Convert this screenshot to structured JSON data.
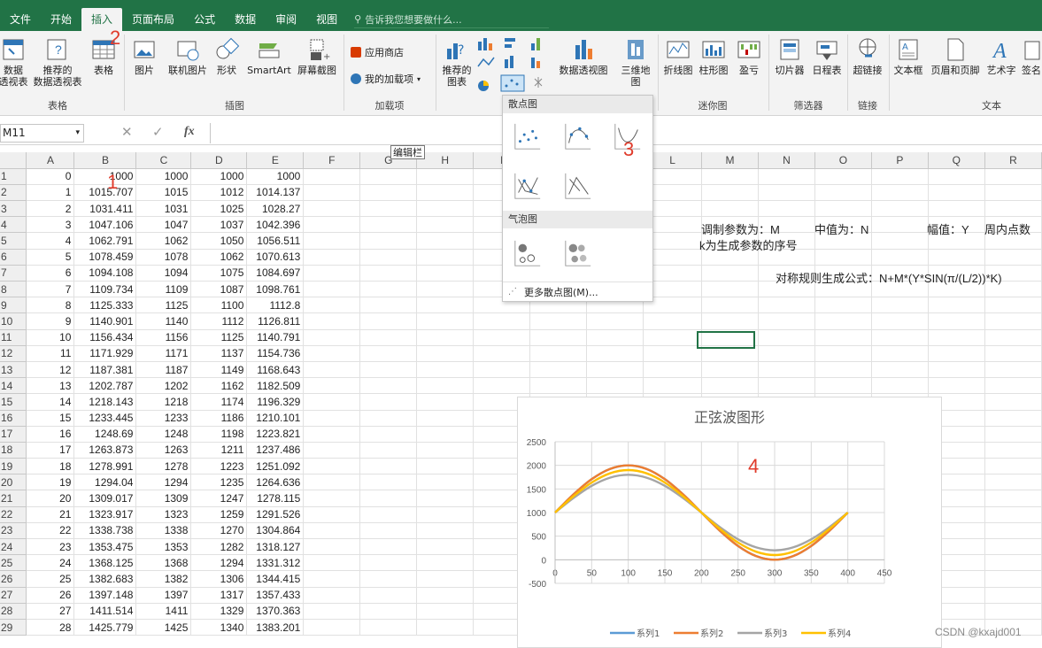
{
  "tabs": [
    "文件",
    "开始",
    "插入",
    "页面布局",
    "公式",
    "数据",
    "审阅",
    "视图"
  ],
  "active_tab": "插入",
  "tell_me": "告诉我您想要做什么...",
  "ribbon": {
    "pivot": "数据\n透视表",
    "rec_pivot": "推荐的\n数据透视表",
    "table": "表格",
    "picture": "图片",
    "online_picture": "联机图片",
    "shapes": "形状",
    "smartart": "SmartArt",
    "screenshot": "屏幕截图",
    "store": "应用商店",
    "my_addins": "我的加载项",
    "rec_charts": "推荐的\n图表",
    "pivot_chart": "数据透视图",
    "map3d": "三维地\n图",
    "line": "折线图",
    "column": "柱形图",
    "winloss": "盈亏",
    "slicer": "切片器",
    "timeline": "日程表",
    "hyperlink": "超链接",
    "textbox": "文本框",
    "header_footer": "页眉和页脚",
    "wordart": "艺术字",
    "signature": "签名",
    "groups": {
      "tables": "表格",
      "illustrations": "插图",
      "addins": "加载项",
      "sparklines": "迷你图",
      "filters": "筛选器",
      "links": "链接",
      "text": "文本"
    }
  },
  "namebox": "M11",
  "fx": "fx",
  "formula_tooltip": "编辑栏",
  "columns": [
    "A",
    "B",
    "C",
    "D",
    "E",
    "F",
    "G",
    "H",
    "I",
    "J",
    "K",
    "L",
    "M",
    "N",
    "O",
    "P",
    "Q",
    "R"
  ],
  "rows": [
    [
      "1",
      "0",
      "1000",
      "1000",
      "1000",
      "1000"
    ],
    [
      "2",
      "1",
      "1015.707",
      "1015",
      "1012",
      "1014.137"
    ],
    [
      "3",
      "2",
      "1031.411",
      "1031",
      "1025",
      "1028.27"
    ],
    [
      "4",
      "3",
      "1047.106",
      "1047",
      "1037",
      "1042.396"
    ],
    [
      "5",
      "4",
      "1062.791",
      "1062",
      "1050",
      "1056.511"
    ],
    [
      "6",
      "5",
      "1078.459",
      "1078",
      "1062",
      "1070.613"
    ],
    [
      "7",
      "6",
      "1094.108",
      "1094",
      "1075",
      "1084.697"
    ],
    [
      "8",
      "7",
      "1109.734",
      "1109",
      "1087",
      "1098.761"
    ],
    [
      "9",
      "8",
      "1125.333",
      "1125",
      "1100",
      "1112.8"
    ],
    [
      "10",
      "9",
      "1140.901",
      "1140",
      "1112",
      "1126.811"
    ],
    [
      "11",
      "10",
      "1156.434",
      "1156",
      "1125",
      "1140.791"
    ],
    [
      "12",
      "11",
      "1171.929",
      "1171",
      "1137",
      "1154.736"
    ],
    [
      "13",
      "12",
      "1187.381",
      "1187",
      "1149",
      "1168.643"
    ],
    [
      "14",
      "13",
      "1202.787",
      "1202",
      "1162",
      "1182.509"
    ],
    [
      "15",
      "14",
      "1218.143",
      "1218",
      "1174",
      "1196.329"
    ],
    [
      "16",
      "15",
      "1233.445",
      "1233",
      "1186",
      "1210.101"
    ],
    [
      "17",
      "16",
      "1248.69",
      "1248",
      "1198",
      "1223.821"
    ],
    [
      "18",
      "17",
      "1263.873",
      "1263",
      "1211",
      "1237.486"
    ],
    [
      "19",
      "18",
      "1278.991",
      "1278",
      "1223",
      "1251.092"
    ],
    [
      "20",
      "19",
      "1294.04",
      "1294",
      "1235",
      "1264.636"
    ],
    [
      "21",
      "20",
      "1309.017",
      "1309",
      "1247",
      "1278.115"
    ],
    [
      "22",
      "21",
      "1323.917",
      "1323",
      "1259",
      "1291.526"
    ],
    [
      "23",
      "22",
      "1338.738",
      "1338",
      "1270",
      "1304.864"
    ],
    [
      "24",
      "23",
      "1353.475",
      "1353",
      "1282",
      "1318.127"
    ],
    [
      "25",
      "24",
      "1368.125",
      "1368",
      "1294",
      "1331.312"
    ],
    [
      "26",
      "25",
      "1382.683",
      "1382",
      "1306",
      "1344.415"
    ],
    [
      "27",
      "26",
      "1397.148",
      "1397",
      "1317",
      "1357.433"
    ],
    [
      "28",
      "27",
      "1411.514",
      "1411",
      "1329",
      "1370.363"
    ],
    [
      "29",
      "28",
      "1425.779",
      "1425",
      "1340",
      "1383.201"
    ]
  ],
  "dropdown": {
    "scatter_header": "散点图",
    "bubble_header": "气泡图",
    "more": "更多散点图(M)..."
  },
  "notes": {
    "line1": "调制参数为：M",
    "mid": "中值为：N",
    "amp": "幅值：Y",
    "period": "周内点数",
    "line2": "k为生成参数的序号",
    "formula": "对称规则生成公式：N+M*(Y*SIN(π/(L/2))*K)"
  },
  "markers": [
    "1",
    "2",
    "3",
    "4"
  ],
  "chart_data": {
    "type": "line",
    "title": "正弦波图形",
    "xticks": [
      "0",
      "50",
      "100",
      "150",
      "200",
      "250",
      "300",
      "350",
      "400",
      "450"
    ],
    "yticks": [
      "2500",
      "2000",
      "1500",
      "1000",
      "500",
      "0",
      "-500"
    ],
    "xlim": [
      0,
      450
    ],
    "ylim": [
      -500,
      2500
    ],
    "x": [
      0,
      25,
      50,
      75,
      100,
      125,
      150,
      175,
      200,
      225,
      250,
      275,
      300,
      325,
      350,
      375,
      400
    ],
    "series": [
      {
        "name": "系列1",
        "color": "#5b9bd5",
        "values": [
          1000,
          1383,
          1707,
          1924,
          2000,
          1924,
          1707,
          1383,
          1000,
          617,
          293,
          76,
          0,
          76,
          293,
          617,
          1000
        ]
      },
      {
        "name": "系列2",
        "color": "#ed7d31",
        "values": [
          1000,
          1383,
          1707,
          1924,
          2000,
          1924,
          1707,
          1383,
          1000,
          617,
          293,
          76,
          0,
          76,
          293,
          617,
          1000
        ]
      },
      {
        "name": "系列3",
        "color": "#a5a5a5",
        "values": [
          1000,
          1306,
          1566,
          1739,
          1800,
          1739,
          1566,
          1306,
          1000,
          694,
          434,
          261,
          200,
          261,
          434,
          694,
          1000
        ]
      },
      {
        "name": "系列4",
        "color": "#ffc000",
        "values": [
          1000,
          1344,
          1636,
          1831,
          1900,
          1831,
          1636,
          1344,
          1000,
          656,
          364,
          169,
          100,
          169,
          364,
          656,
          1000
        ]
      }
    ]
  },
  "watermark": "CSDN @kxajd001"
}
